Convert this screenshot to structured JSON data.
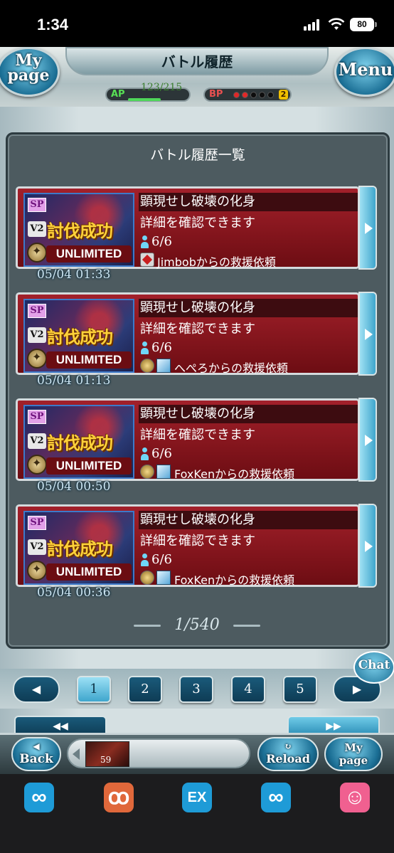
{
  "status_bar": {
    "time": "1:34",
    "battery": "80"
  },
  "header": {
    "mypage_label": "My\npage",
    "title": "バトル履歴",
    "menu_label": "Menu",
    "ap_label": "AP",
    "ap_value": "123/215",
    "ap_fraction": 0.572,
    "bp_label": "BP",
    "bp_filled": 2,
    "bp_total": 5,
    "bp_count": "2"
  },
  "panel": {
    "title": "バトル履歴一覧"
  },
  "entries": [
    {
      "sp": "SP",
      "v2": "V2",
      "result": "討伐成功",
      "difficulty": "UNLIMITED",
      "name": "顕現せし破壊の化身",
      "detail": "詳細を確認できます",
      "count": "6/6",
      "request": "Jimbobからの救援依頼",
      "date": "05/04 01:33"
    },
    {
      "sp": "SP",
      "v2": "V2",
      "result": "討伐成功",
      "difficulty": "UNLIMITED",
      "name": "顕現せし破壊の化身",
      "detail": "詳細を確認できます",
      "count": "6/6",
      "request": "へぺろからの救援依頼",
      "date": "05/04 01:13"
    },
    {
      "sp": "SP",
      "v2": "V2",
      "result": "討伐成功",
      "difficulty": "UNLIMITED",
      "name": "顕現せし破壊の化身",
      "detail": "詳細を確認できます",
      "count": "6/6",
      "request": "FoxKenからの救援依頼",
      "date": "05/04 00:50"
    },
    {
      "sp": "SP",
      "v2": "V2",
      "result": "討伐成功",
      "difficulty": "UNLIMITED",
      "name": "顕現せし破壊の化身",
      "detail": "詳細を確認できます",
      "count": "6/6",
      "request": "FoxKenからの救援依頼",
      "date": "05/04 00:36"
    }
  ],
  "pagination": {
    "indicator": "1/540",
    "prev": "◀",
    "next": "▶",
    "pages": [
      "1",
      "2",
      "3",
      "4",
      "5"
    ],
    "current_page": "1",
    "rewind": "◀◀",
    "forward": "▶▶"
  },
  "chat_label": "Chat",
  "footer": {
    "back_label": "Back",
    "reload_label": "Reload",
    "mypage_label": "My\npage",
    "assist_count": "59"
  },
  "dock": {
    "icons": [
      {
        "name": "infinity-app-icon",
        "glyph": "∞",
        "color": "#1e9bd7"
      },
      {
        "name": "leaf-app-icon",
        "glyph": "ꝏ",
        "color": "#e0683b"
      },
      {
        "name": "ex-app-icon",
        "glyph": "EX",
        "color": "#1e9bd7"
      },
      {
        "name": "infinity-app-icon-2",
        "glyph": "∞",
        "color": "#1e9bd7"
      },
      {
        "name": "character-app-icon",
        "glyph": "☺",
        "color": "#f06090"
      }
    ]
  }
}
